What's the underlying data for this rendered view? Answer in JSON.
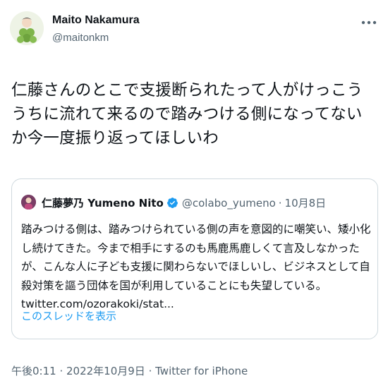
{
  "author": {
    "display_name": "Maito Nakamura",
    "handle": "@maitonkm"
  },
  "tweet": {
    "text": "仁藤さんのとこで支援断られたって人がけっこううちに流れて来るので踏みつける側になってないか今一度振り返ってほしいわ"
  },
  "quote": {
    "display_name": "仁藤夢乃 Yumeno Nito",
    "handle": "@colabo_yumeno",
    "separator": "·",
    "date": "10月8日",
    "text": "踏みつける側は、踏みつけられている側の声を意図的に嘲笑い、矮小化し続けてきた。今まで相手にするのも馬鹿馬鹿しくて言及しなかったが、こんな人に子ども支援に関わらないでほしいし、ビジネスとして自殺対策を謳う団体を国が利用していることにも失望している。 twitter.com/ozorakoki/stat...",
    "show_thread": "このスレッドを表示"
  },
  "meta": {
    "time": "午後0:11",
    "separator1": " · ",
    "date": "2022年10月9日",
    "separator2": " · ",
    "source": "Twitter for iPhone"
  },
  "icons": {
    "more": "more-horizontal-icon",
    "verified": "verified-badge-icon"
  },
  "colors": {
    "link": "#1d9bf0",
    "secondary_text": "#536471",
    "border": "#cfd9de",
    "verified": "#1d9bf0"
  }
}
